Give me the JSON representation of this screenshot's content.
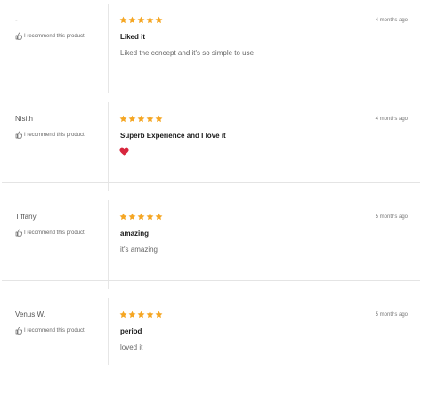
{
  "accent": "#f5a623",
  "reviews": [
    {
      "name": "-",
      "recommend": "I recommend this product",
      "rating": 5,
      "date": "4 months ago",
      "title": "Liked it",
      "body": "Liked the concept and it's so simple to use",
      "emoji": ""
    },
    {
      "name": "Nisith",
      "recommend": "I recommend this product",
      "rating": 5,
      "date": "4 months ago",
      "title": "Superb Experience and I love it",
      "body": "",
      "emoji": "heart-emoji"
    },
    {
      "name": "Tiffany",
      "recommend": "I recommend this product",
      "rating": 5,
      "date": "5 months ago",
      "title": "amazing",
      "body": "it's amazing",
      "emoji": ""
    },
    {
      "name": "Venus W.",
      "recommend": "I recommend this product",
      "rating": 5,
      "date": "5 months ago",
      "title": "period",
      "body": "loved it",
      "emoji": ""
    }
  ]
}
